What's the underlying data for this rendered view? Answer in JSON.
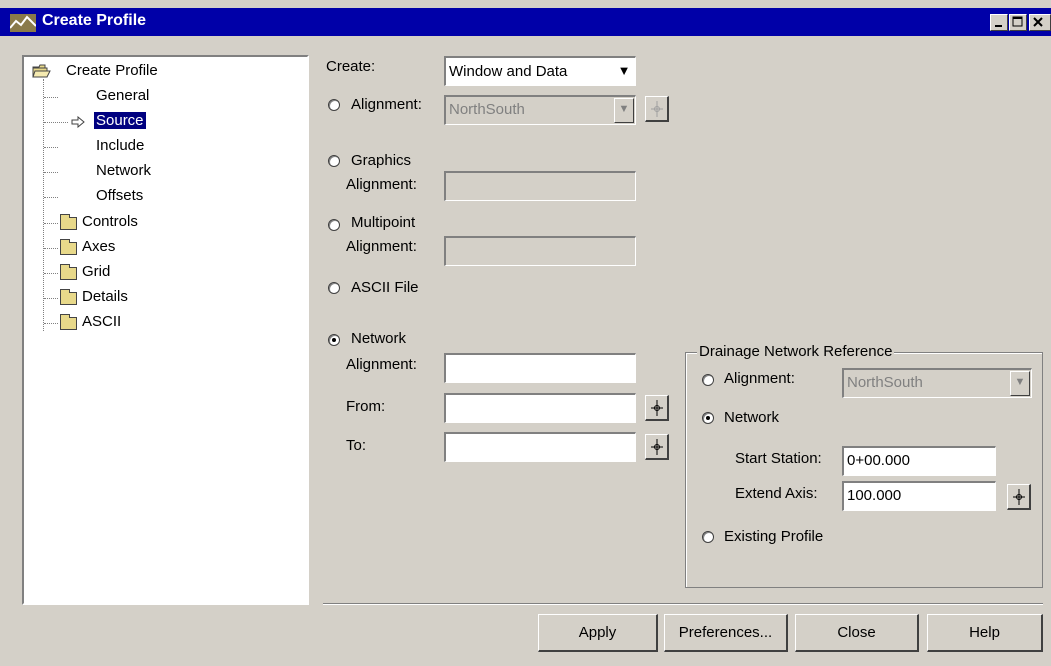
{
  "window": {
    "title": "Create Profile"
  },
  "tree": {
    "root": "Create Profile",
    "items": [
      "General",
      "Source",
      "Include",
      "Network",
      "Offsets"
    ],
    "folders": [
      "Controls",
      "Axes",
      "Grid",
      "Details",
      "ASCII"
    ],
    "selected": "Source"
  },
  "form": {
    "create_label": "Create:",
    "create_value": "Window and Data",
    "alignment_label": "Alignment:",
    "alignment_value": "NorthSouth",
    "graphics_label": "Graphics",
    "graphics_alignment_label": "Alignment:",
    "multipoint_label": "Multipoint",
    "multipoint_alignment_label": "Alignment:",
    "ascii_label": "ASCII File",
    "network_label": "Network",
    "network_alignment_label": "Alignment:",
    "from_label": "From:",
    "to_label": "To:"
  },
  "drainage": {
    "title": "Drainage Network Reference",
    "alignment_label": "Alignment:",
    "alignment_value": "NorthSouth",
    "network_label": "Network",
    "start_station_label": "Start Station:",
    "start_station_value": "0+00.000",
    "extend_axis_label": "Extend Axis:",
    "extend_axis_value": "100.000",
    "existing_profile_label": "Existing Profile"
  },
  "buttons": {
    "apply": "Apply",
    "preferences": "Preferences...",
    "close": "Close",
    "help": "Help"
  }
}
